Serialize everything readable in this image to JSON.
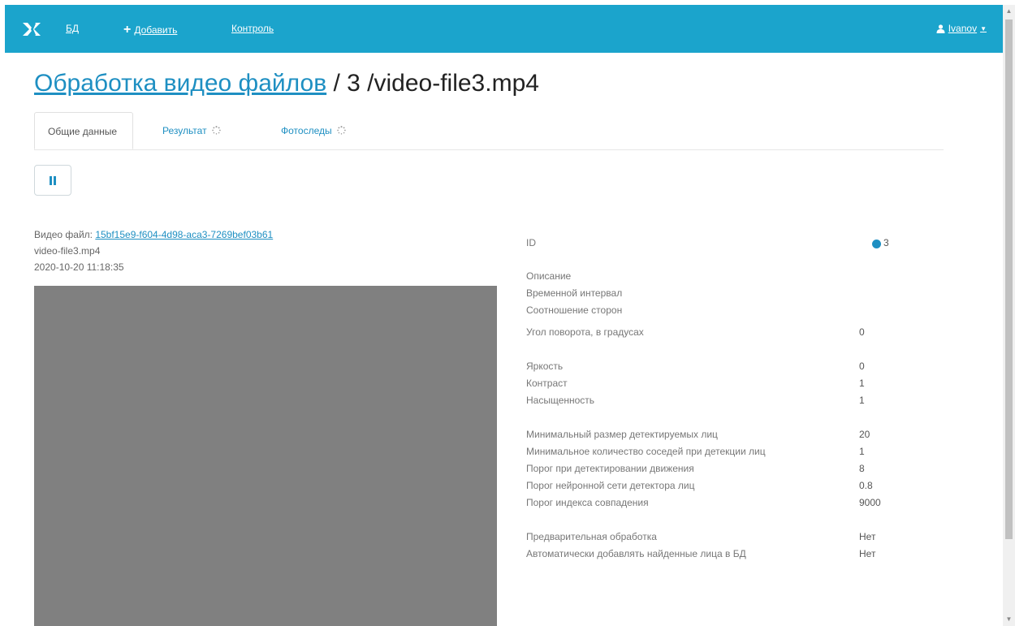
{
  "nav": {
    "db_label": "БД",
    "add_label": "Добавить",
    "control_label": "Контроль",
    "user_label": "Ivanov",
    "brand_color": "#1ba4cc"
  },
  "title": {
    "link": "Обработка видео файлов",
    "rest": " / 3 /video-file3.mp4"
  },
  "tabs": [
    {
      "label": "Общие данные",
      "active": true
    },
    {
      "label": "Результат",
      "icon": "spinner-icon"
    },
    {
      "label": "Фотоследы",
      "icon": "spinner-icon"
    }
  ],
  "file": {
    "prefix": "Видео файл:",
    "guid": "15bf15e9-f604-4d98-aca3-7269bef03b61",
    "name": "video-file3.mp4",
    "datetime": "2020-10-20 11:18:35"
  },
  "props": {
    "id_label": "ID",
    "id_value": "3",
    "rows": [
      {
        "label": "Описание",
        "value": ""
      },
      {
        "label": "Временной интервал",
        "value": ""
      },
      {
        "label": "Соотношение сторон",
        "value": ""
      },
      {
        "label": "Угол поворота, в градусах",
        "value": "0"
      },
      {
        "label": "Яркость",
        "value": "0"
      },
      {
        "label": "Контраст",
        "value": "1"
      },
      {
        "label": "Насыщенность",
        "value": "1"
      },
      {
        "label": "Минимальный размер детектируемых лиц",
        "value": "20"
      },
      {
        "label": "Минимальное количество соседей при детекции лиц",
        "value": "1"
      },
      {
        "label": "Порог при детектировании движения",
        "value": "8"
      },
      {
        "label": "Порог нейронной сети детектора лиц",
        "value": "0.8"
      },
      {
        "label": "Порог индекса совпадения",
        "value": "9000"
      },
      {
        "label": "Предварительная обработка",
        "value": "Нет"
      },
      {
        "label": "Автоматически добавлять найденные лица в БД",
        "value": "Нет"
      }
    ]
  }
}
